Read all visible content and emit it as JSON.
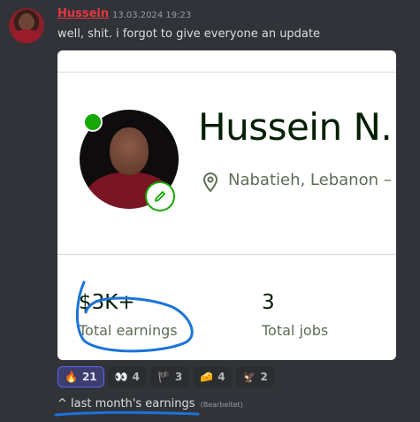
{
  "message": {
    "author": "Hussein",
    "timestamp": "13.03.2024 19:23",
    "text": "well, shit. i forgot to give everyone an update"
  },
  "profile_card": {
    "name": "Hussein N.",
    "location": "Nabatieh, Lebanon –",
    "stats": [
      {
        "value": "$3K+",
        "label": "Total earnings"
      },
      {
        "value": "3",
        "label": "Total jobs"
      }
    ]
  },
  "reactions": [
    {
      "emoji": "🔥",
      "icon": "fire-icon",
      "count": "21",
      "active": true
    },
    {
      "emoji": "👀",
      "icon": "eyes-icon",
      "count": "4",
      "active": false
    },
    {
      "emoji": "🏴",
      "icon": "england-flag-icon",
      "count": "3",
      "active": false
    },
    {
      "emoji": "🧀",
      "icon": "cheese-icon",
      "count": "4",
      "active": false
    },
    {
      "emoji": "🦅",
      "icon": "eagle-icon",
      "count": "2",
      "active": false
    }
  ],
  "followup": {
    "text": "^ last month's earnings",
    "edited_label": "(Bearbeitet)"
  },
  "colors": {
    "background": "#313338",
    "username": "#e3363f",
    "online_status": "#14a800",
    "annotation_ink": "#1a73d9",
    "active_reaction_border": "#5865f2"
  }
}
